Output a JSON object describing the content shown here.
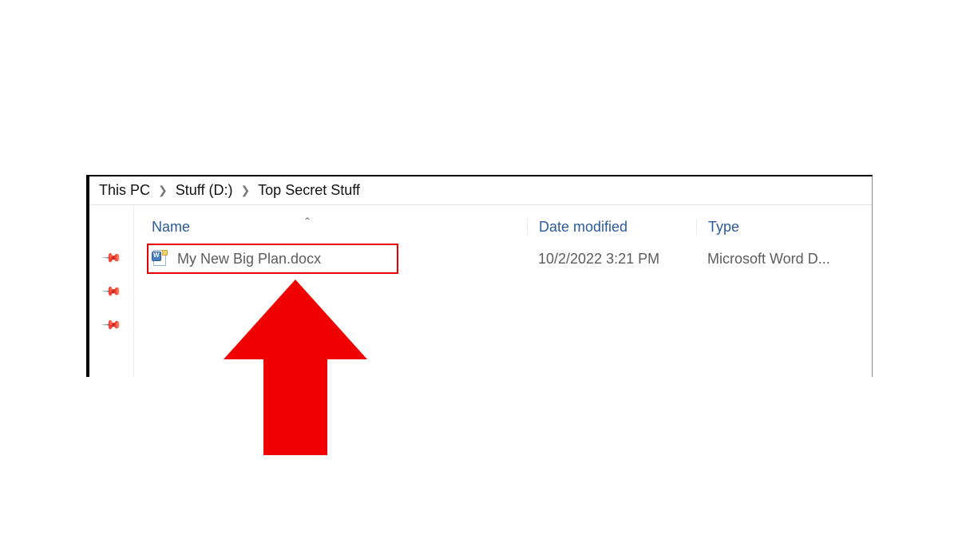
{
  "breadcrumb": {
    "segments": [
      "This PC",
      "Stuff (D:)",
      "Top Secret Stuff"
    ]
  },
  "columns": {
    "name": "Name",
    "date_modified": "Date modified",
    "type": "Type"
  },
  "files": [
    {
      "name": "My New Big Plan.docx",
      "date_modified": "10/2/2022 3:21 PM",
      "type": "Microsoft Word D..."
    }
  ]
}
